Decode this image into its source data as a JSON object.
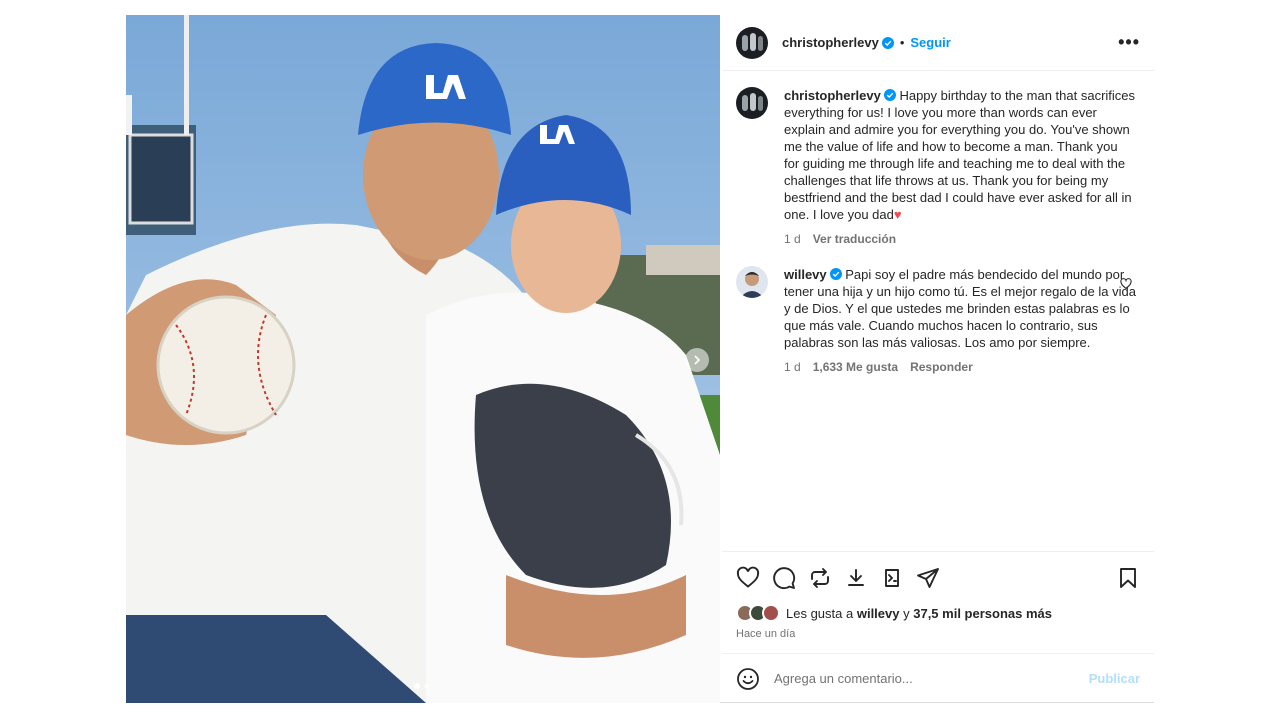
{
  "post": {
    "author": {
      "username": "christopherlevy",
      "verified": true,
      "follow_label": "Seguir",
      "bullet": "•",
      "more_label": "•••"
    },
    "caption": {
      "username": "christopherlevy",
      "text": "Happy birthday to the man that sacrifices everything for us! I love you more than words can ever explain and admire you for everything you do. You've shown me the value of life and how to become a man. Thank you for guiding me through life and teaching me to deal with the challenges that life throws at us. Thank you for being my bestfriend and the best dad I could have ever asked for all in one. I love you dad",
      "emoji": "♥",
      "time": "1 d",
      "translate_label": "Ver traducción"
    },
    "comments": [
      {
        "username": "willevy",
        "verified": true,
        "text": "Papi soy el padre más bendecido del mundo por tener una hija y un hijo como tú. Es el mejor regalo de la vida y de Dios. Y el que ustedes me brinden estas palabras es lo que más vale. Cuando muchos hacen lo contrario, sus palabras son las más valiosas. Los amo por siempre.",
        "time": "1 d",
        "likes": "1,633 Me gusta",
        "reply_label": "Responder"
      }
    ],
    "actions": {
      "icons": [
        "heart-icon",
        "comment-icon",
        "repost-icon",
        "download-icon",
        "screen-icon",
        "share-icon",
        "bookmark-icon"
      ]
    },
    "likes": {
      "prefix": "Les gusta a",
      "user": "willevy",
      "connector": "y",
      "others": "37,5 mil personas más"
    },
    "timestamp": "Hace un día",
    "comment_input": {
      "placeholder": "Agrega un comentario...",
      "post_label": "Publicar"
    },
    "carousel": {
      "index": 1,
      "count": 2
    }
  },
  "colors": {
    "accent": "#0095f6",
    "muted": "#737373",
    "post_disabled": "#b2dffc",
    "heart": "#ed4956"
  }
}
